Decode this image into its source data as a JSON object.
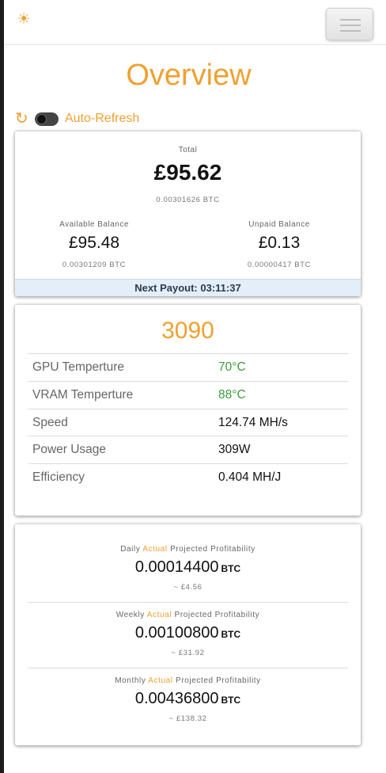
{
  "header": {
    "theme_icon": "sun-icon",
    "menu_icon": "hamburger-icon"
  },
  "page_title": "Overview",
  "refresh": {
    "icon": "refresh-icon",
    "label": "Auto-Refresh",
    "enabled": false
  },
  "balance": {
    "total_label": "Total",
    "total_value": "£95.62",
    "total_btc": "0.00301626 BTC",
    "available_label": "Available Balance",
    "available_value": "£95.48",
    "available_btc": "0.00301209 BTC",
    "unpaid_label": "Unpaid Balance",
    "unpaid_value": "£0.13",
    "unpaid_btc": "0.00000417 BTC",
    "next_payout": "Next Payout: 03:11:37"
  },
  "gpu": {
    "name": "3090",
    "rows": [
      {
        "label": "GPU Temperture",
        "value": "70°C"
      },
      {
        "label": "VRAM Temperture",
        "value": "88°C"
      },
      {
        "label": "Speed",
        "value": "124.74 MH/s"
      },
      {
        "label": "Power Usage",
        "value": "309W"
      },
      {
        "label": "Efficiency",
        "value": "0.404 MH/J"
      }
    ],
    "status_color": "#3a9a3a"
  },
  "profitability": {
    "highlight_word": "Actual",
    "suffix": "Projected Profitability",
    "unit": "BTC",
    "items": [
      {
        "period": "Daily",
        "value": "0.00014400",
        "fiat": "~ £4.56"
      },
      {
        "period": "Weekly",
        "value": "0.00100800",
        "fiat": "~ £31.92"
      },
      {
        "period": "Monthly",
        "value": "0.00436800",
        "fiat": "~ £138.32"
      }
    ]
  },
  "colors": {
    "accent": "#f0a030",
    "payout_bar": "#e3eef8"
  }
}
